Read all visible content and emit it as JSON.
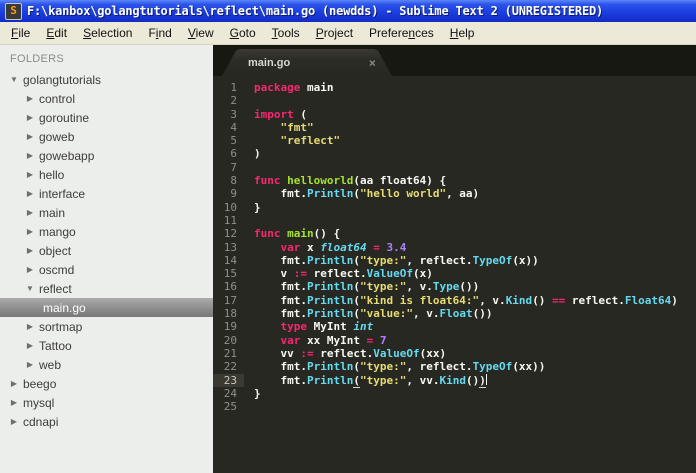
{
  "window": {
    "title": "F:\\kanbox\\golangtutorials\\reflect\\main.go (newdds) - Sublime Text 2 (UNREGISTERED)"
  },
  "icons": {
    "app": "S",
    "close": "×",
    "expanded": "▼",
    "collapsed": "▶"
  },
  "menu": {
    "items": [
      {
        "label": "File",
        "mnemonic": 0
      },
      {
        "label": "Edit",
        "mnemonic": 0
      },
      {
        "label": "Selection",
        "mnemonic": 0
      },
      {
        "label": "Find",
        "mnemonic": 1
      },
      {
        "label": "View",
        "mnemonic": 0
      },
      {
        "label": "Goto",
        "mnemonic": 0
      },
      {
        "label": "Tools",
        "mnemonic": 0
      },
      {
        "label": "Project",
        "mnemonic": 0
      },
      {
        "label": "Preferences",
        "mnemonic": 7
      },
      {
        "label": "Help",
        "mnemonic": 0
      }
    ]
  },
  "sidebar": {
    "header": "FOLDERS",
    "items": [
      {
        "label": "golangtutorials",
        "level": 0,
        "state": "expanded",
        "selected": false
      },
      {
        "label": "control",
        "level": 1,
        "state": "collapsed",
        "selected": false
      },
      {
        "label": "goroutine",
        "level": 1,
        "state": "collapsed",
        "selected": false
      },
      {
        "label": "goweb",
        "level": 1,
        "state": "collapsed",
        "selected": false
      },
      {
        "label": "gowebapp",
        "level": 1,
        "state": "collapsed",
        "selected": false
      },
      {
        "label": "hello",
        "level": 1,
        "state": "collapsed",
        "selected": false
      },
      {
        "label": "interface",
        "level": 1,
        "state": "collapsed",
        "selected": false
      },
      {
        "label": "main",
        "level": 1,
        "state": "collapsed",
        "selected": false
      },
      {
        "label": "mango",
        "level": 1,
        "state": "collapsed",
        "selected": false
      },
      {
        "label": "object",
        "level": 1,
        "state": "collapsed",
        "selected": false
      },
      {
        "label": "oscmd",
        "level": 1,
        "state": "collapsed",
        "selected": false
      },
      {
        "label": "reflect",
        "level": 1,
        "state": "expanded",
        "selected": false
      },
      {
        "label": "main.go",
        "level": 2,
        "state": "file",
        "selected": true
      },
      {
        "label": "sortmap",
        "level": 1,
        "state": "collapsed",
        "selected": false
      },
      {
        "label": "Tattoo",
        "level": 1,
        "state": "collapsed",
        "selected": false
      },
      {
        "label": "web",
        "level": 1,
        "state": "collapsed",
        "selected": false
      },
      {
        "label": "beego",
        "level": 0,
        "state": "collapsed",
        "selected": false
      },
      {
        "label": "mysql",
        "level": 0,
        "state": "collapsed",
        "selected": false
      },
      {
        "label": "cdnapi",
        "level": 0,
        "state": "collapsed",
        "selected": false
      }
    ]
  },
  "tabs": [
    {
      "label": "main.go",
      "active": true
    }
  ],
  "editor": {
    "language": "go",
    "current_line": 23,
    "colors": {
      "background": "#272822",
      "foreground": "#f8f8f2",
      "keyword": "#f92672",
      "function_name": "#a6e22e",
      "string": "#e6db74",
      "type_and_support": "#66d9ef",
      "number": "#ae81ff",
      "line_number": "#8f908a",
      "sidebar_bg": "#eceeec",
      "titlebar_blue": "#1c3fe0"
    },
    "lines": [
      {
        "num": 1,
        "tokens": [
          [
            "k",
            "package"
          ],
          [
            "p",
            " main"
          ]
        ]
      },
      {
        "num": 2,
        "tokens": []
      },
      {
        "num": 3,
        "tokens": [
          [
            "k",
            "import"
          ],
          [
            "p",
            " ("
          ]
        ]
      },
      {
        "num": 4,
        "tokens": [
          [
            "p",
            "    "
          ],
          [
            "s",
            "\"fmt\""
          ]
        ]
      },
      {
        "num": 5,
        "tokens": [
          [
            "p",
            "    "
          ],
          [
            "s",
            "\"reflect\""
          ]
        ]
      },
      {
        "num": 6,
        "tokens": [
          [
            "p",
            ")"
          ]
        ]
      },
      {
        "num": 7,
        "tokens": []
      },
      {
        "num": 8,
        "tokens": [
          [
            "k",
            "func"
          ],
          [
            "p",
            " "
          ],
          [
            "f",
            "helloworld"
          ],
          [
            "p",
            "(aa float64) {"
          ]
        ]
      },
      {
        "num": 9,
        "tokens": [
          [
            "p",
            "    fmt."
          ],
          [
            "c",
            "Println"
          ],
          [
            "p",
            "("
          ],
          [
            "s",
            "\"hello world\""
          ],
          [
            "p",
            ", aa)"
          ]
        ]
      },
      {
        "num": 10,
        "tokens": [
          [
            "p",
            "}"
          ]
        ]
      },
      {
        "num": 11,
        "tokens": []
      },
      {
        "num": 12,
        "tokens": [
          [
            "k",
            "func"
          ],
          [
            "p",
            " "
          ],
          [
            "f",
            "main"
          ],
          [
            "p",
            "() {"
          ]
        ]
      },
      {
        "num": 13,
        "tokens": [
          [
            "p",
            "    "
          ],
          [
            "k",
            "var"
          ],
          [
            "p",
            " x "
          ],
          [
            "t",
            "float64"
          ],
          [
            "p",
            " "
          ],
          [
            "o",
            "="
          ],
          [
            "p",
            " "
          ],
          [
            "n",
            "3.4"
          ]
        ]
      },
      {
        "num": 14,
        "tokens": [
          [
            "p",
            "    fmt."
          ],
          [
            "c",
            "Println"
          ],
          [
            "p",
            "("
          ],
          [
            "s",
            "\"type:\""
          ],
          [
            "p",
            ", reflect."
          ],
          [
            "c",
            "TypeOf"
          ],
          [
            "p",
            "(x))"
          ]
        ]
      },
      {
        "num": 15,
        "tokens": [
          [
            "p",
            "    v "
          ],
          [
            "o",
            ":="
          ],
          [
            "p",
            " reflect."
          ],
          [
            "c",
            "ValueOf"
          ],
          [
            "p",
            "(x)"
          ]
        ]
      },
      {
        "num": 16,
        "tokens": [
          [
            "p",
            "    fmt."
          ],
          [
            "c",
            "Println"
          ],
          [
            "p",
            "("
          ],
          [
            "s",
            "\"type:\""
          ],
          [
            "p",
            ", v."
          ],
          [
            "c",
            "Type"
          ],
          [
            "p",
            "())"
          ]
        ]
      },
      {
        "num": 17,
        "tokens": [
          [
            "p",
            "    fmt."
          ],
          [
            "c",
            "Println"
          ],
          [
            "p",
            "("
          ],
          [
            "s",
            "\"kind is float64:\""
          ],
          [
            "p",
            ", v."
          ],
          [
            "c",
            "Kind"
          ],
          [
            "p",
            "() "
          ],
          [
            "o",
            "=="
          ],
          [
            "p",
            " reflect."
          ],
          [
            "c",
            "Float64"
          ],
          [
            "p",
            ")"
          ]
        ]
      },
      {
        "num": 18,
        "tokens": [
          [
            "p",
            "    fmt."
          ],
          [
            "c",
            "Println"
          ],
          [
            "p",
            "("
          ],
          [
            "s",
            "\"value:\""
          ],
          [
            "p",
            ", v."
          ],
          [
            "c",
            "Float"
          ],
          [
            "p",
            "())"
          ]
        ]
      },
      {
        "num": 19,
        "tokens": [
          [
            "p",
            "    "
          ],
          [
            "k",
            "type"
          ],
          [
            "p",
            " MyInt "
          ],
          [
            "t",
            "int"
          ]
        ]
      },
      {
        "num": 20,
        "tokens": [
          [
            "p",
            "    "
          ],
          [
            "k",
            "var"
          ],
          [
            "p",
            " xx MyInt "
          ],
          [
            "o",
            "="
          ],
          [
            "p",
            " "
          ],
          [
            "n",
            "7"
          ]
        ]
      },
      {
        "num": 21,
        "tokens": [
          [
            "p",
            "    vv "
          ],
          [
            "o",
            ":="
          ],
          [
            "p",
            " reflect."
          ],
          [
            "c",
            "ValueOf"
          ],
          [
            "p",
            "(xx)"
          ]
        ]
      },
      {
        "num": 22,
        "tokens": [
          [
            "p",
            "    fmt."
          ],
          [
            "c",
            "Println"
          ],
          [
            "p",
            "("
          ],
          [
            "s",
            "\"type:\""
          ],
          [
            "p",
            ", reflect."
          ],
          [
            "c",
            "TypeOf"
          ],
          [
            "p",
            "(xx))"
          ]
        ]
      },
      {
        "num": 23,
        "tokens": [
          [
            "p",
            "    fmt."
          ],
          [
            "c",
            "Println"
          ],
          [
            "pu",
            "("
          ],
          [
            "s",
            "\"type:\""
          ],
          [
            "p",
            ", vv."
          ],
          [
            "c",
            "Kind"
          ],
          [
            "p",
            "()"
          ],
          [
            "pu",
            ")"
          ],
          [
            "caret",
            ""
          ]
        ]
      },
      {
        "num": 24,
        "tokens": [
          [
            "p",
            "}"
          ]
        ]
      },
      {
        "num": 25,
        "tokens": []
      }
    ]
  }
}
